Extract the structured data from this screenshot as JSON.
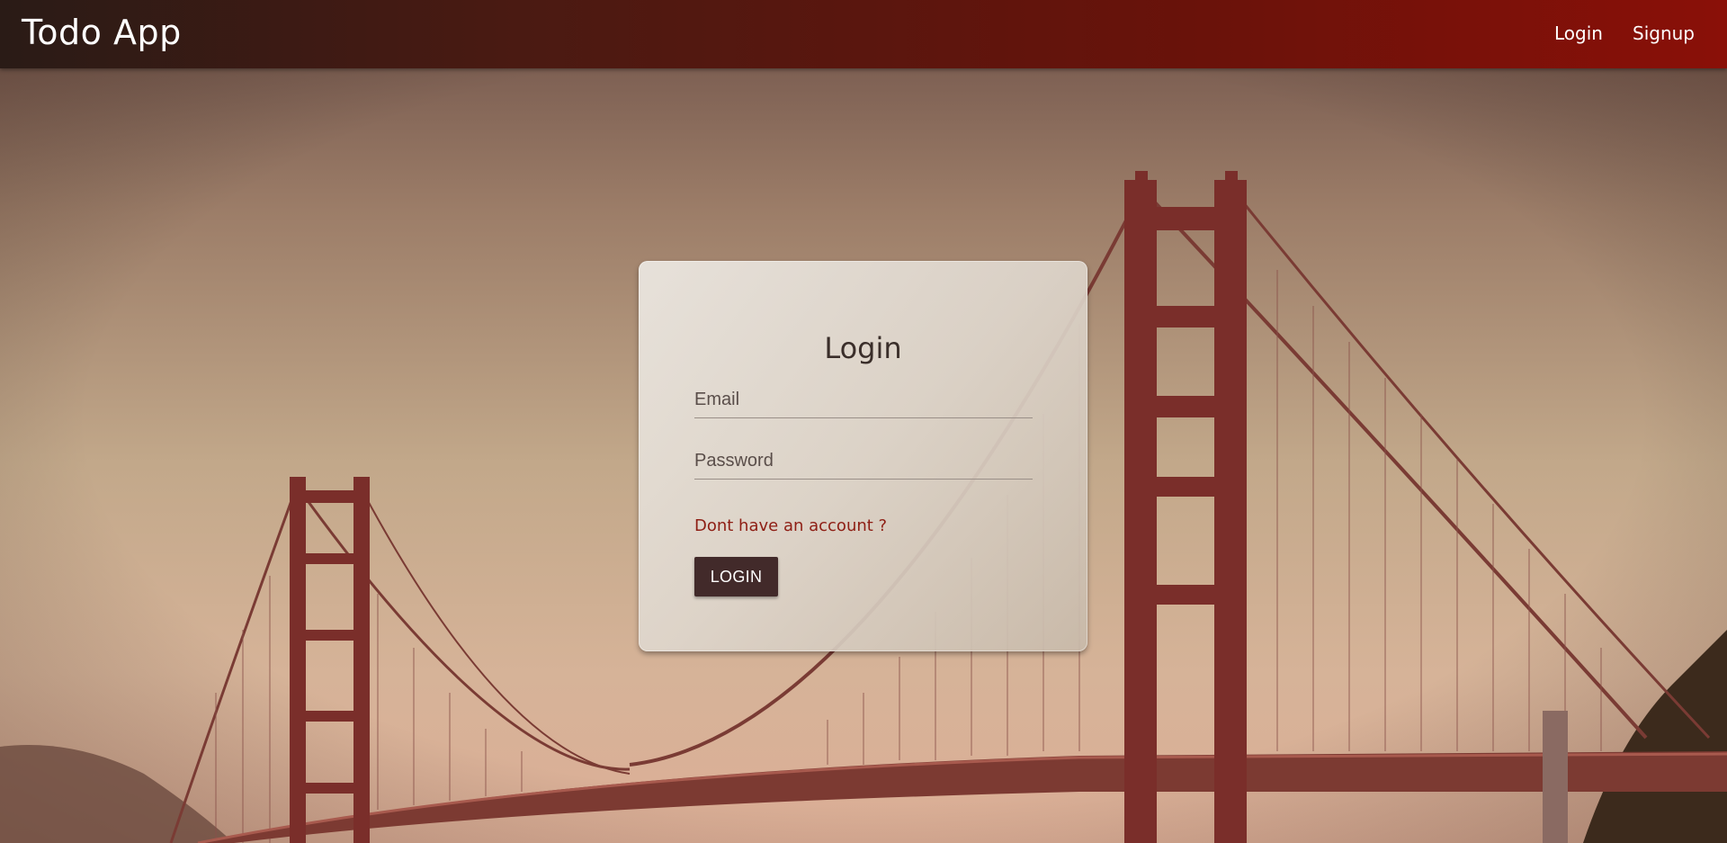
{
  "navbar": {
    "brand": "Todo App",
    "links": [
      {
        "label": "Login"
      },
      {
        "label": "Signup"
      }
    ]
  },
  "login_card": {
    "title": "Login",
    "email_placeholder": "Email",
    "password_placeholder": "Password",
    "signup_prompt": "Dont have an account ?",
    "submit_label": "LOGIN"
  },
  "colors": {
    "navbar_start": "#2a1b16",
    "navbar_end": "#8a1008",
    "link_accent": "#8e1e14",
    "button_bg": "#422a2a"
  },
  "background": {
    "image_subject": "golden-gate-bridge"
  }
}
